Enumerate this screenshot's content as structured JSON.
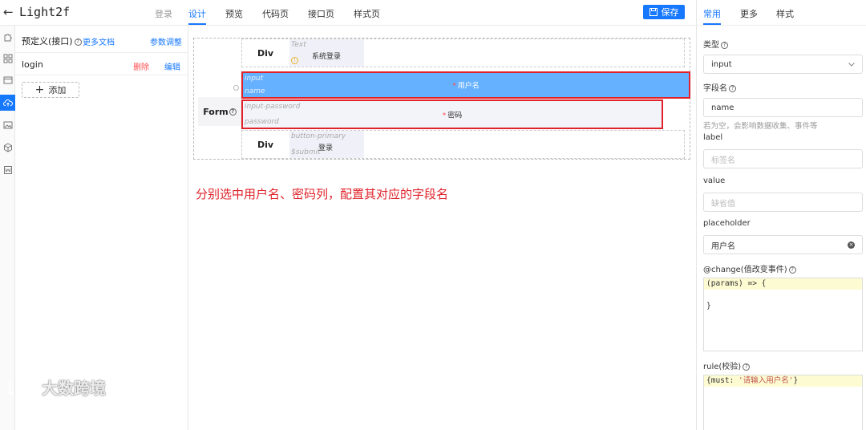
{
  "header": {
    "app_title": "Light2f",
    "tabs": [
      {
        "label": "登录",
        "state": "dim"
      },
      {
        "label": "设计",
        "state": "active"
      },
      {
        "label": "预览",
        "state": "normal"
      },
      {
        "label": "代码页",
        "state": "normal"
      },
      {
        "label": "接口页",
        "state": "normal"
      },
      {
        "label": "样式页",
        "state": "normal"
      }
    ],
    "save_label": "保存"
  },
  "rail_icons": [
    "puzzle-icon",
    "grid-icon",
    "window-icon",
    "cloud-upload-icon",
    "image-icon",
    "package-icon",
    "word-icon"
  ],
  "left_panel": {
    "title": "预定义(接口)",
    "docs_link": "更多文档",
    "tune_link": "参数调整",
    "items": [
      {
        "name": "login",
        "delete_label": "删除",
        "edit_label": "编辑"
      }
    ],
    "add_label": "添加"
  },
  "canvas": {
    "form_label": "Form",
    "rows": {
      "title": {
        "div_label": "Div",
        "ghost_type": "Text",
        "text": "系统登录"
      },
      "username": {
        "ghost_type": "input",
        "ghost_sub": "name",
        "label": "用户名"
      },
      "password": {
        "ghost_type": "input-password",
        "ghost_sub": "password",
        "label": "密码"
      },
      "submit": {
        "div_label": "Div",
        "ghost_type": "button-primary",
        "ghost_sub": "$submit",
        "text": "登录"
      }
    },
    "annotation": "分别选中用户名、密码列，配置其对应的字段名",
    "watermark": "大数跨境"
  },
  "right_panel": {
    "tabs": [
      {
        "label": "常用",
        "state": "active"
      },
      {
        "label": "更多",
        "state": "normal"
      },
      {
        "label": "样式",
        "state": "normal"
      }
    ],
    "type": {
      "label": "类型",
      "value": "input"
    },
    "field_name": {
      "label": "字段名",
      "value": "name",
      "hint": "若为空，会影响数据收集、事件等"
    },
    "label_field": {
      "label": "label",
      "placeholder": "标签名"
    },
    "value_field": {
      "label": "value",
      "placeholder": "缺省值"
    },
    "placeholder_field": {
      "label": "placeholder",
      "value": "用户名"
    },
    "change_event": {
      "label": "@change(值改变事件)",
      "lines": [
        "(params) => {",
        "",
        "}"
      ]
    },
    "rule": {
      "label": "rule(校验)",
      "code_prefix": "{must: ",
      "code_string": "'请输入用户名'",
      "code_suffix": "}"
    }
  },
  "colors": {
    "accent": "#1677ff",
    "danger": "#ff4d4f",
    "highlight_red": "#e0232a",
    "selected_row": "#66b1ff"
  }
}
